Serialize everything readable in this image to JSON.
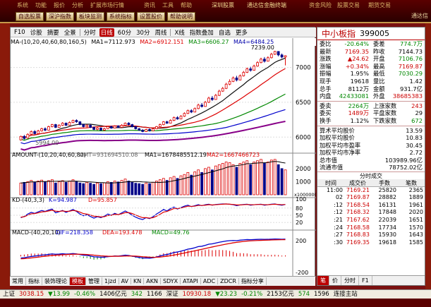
{
  "menu": {
    "row1": [
      "系统",
      "功能",
      "报价",
      "分析",
      "扩展市场行情",
      "资讯",
      "工具",
      "帮助",
      "深圳股票",
      "通达信金融终端",
      "资金风险",
      "股票交易",
      "期货交易"
    ],
    "buttons": [
      "自选股票",
      "深沪指数",
      "板块监测",
      "系统指标",
      "设置股价",
      "帮助说明"
    ],
    "right_label": "通达信"
  },
  "toolbar": {
    "items": [
      "F10",
      "诊股",
      "摘要",
      "全景",
      "分时",
      "日线",
      "60分",
      "30分",
      "周线",
      "X线",
      "指数叠加",
      "自选",
      "更多"
    ],
    "selected": "日线"
  },
  "price_legend": {
    "label": "MA-(10,20,40,60,80,160,5)",
    "ma1": "MA1=7112.973",
    "ma2": "MA2=6912.151",
    "ma3": "MA3=6606.27",
    "ma4": "MA4=6484.25"
  },
  "amount_legend": {
    "label": "AMOUNT-(10,20,40,60,80)",
    "amt": "AMT=931694510.08",
    "ma1": "MA1=1678485512.19",
    "ma2": "MA2=1667466723"
  },
  "kd_legend": {
    "label": "KD-(40,3,3)",
    "k": "K=94.987",
    "d": "D=95.857"
  },
  "macd_legend": {
    "label": "MACD-(40,20,10)",
    "dif": "DIF=218.358",
    "dea": "DEA=193.478",
    "macd": "MACD=49.76"
  },
  "bottomtabs": {
    "items": [
      "常用",
      "指标",
      "装饰理论",
      "模板",
      "管理",
      "1jzd",
      "AV",
      "KN",
      "AKN",
      "SDYX",
      "ATAPI",
      "ADC",
      "ZDCR",
      "指标分享"
    ],
    "selected": "模板"
  },
  "quote": {
    "name": "中小板指",
    "code": "399005",
    "rows": [
      [
        [
          "委比",
          "-20.64%",
          "green"
        ],
        [
          "委差",
          "774.7万",
          "green"
        ]
      ],
      [
        [
          "最新",
          "7169.35",
          "red"
        ],
        [
          "昨收",
          "7144.73",
          ""
        ]
      ],
      [
        [
          "涨跌",
          "▲24.62",
          "red"
        ],
        [
          "开盘",
          "7106.76",
          "green"
        ]
      ],
      [
        [
          "涨幅",
          "+0.34%",
          "red"
        ],
        [
          "最高",
          "7169.87",
          "red"
        ]
      ],
      [
        [
          "振幅",
          "1.95%",
          ""
        ],
        [
          "最低",
          "7030.29",
          "green"
        ]
      ],
      [
        [
          "现手",
          "19618",
          ""
        ],
        [
          "量比",
          "1.42",
          ""
        ]
      ],
      [
        [
          "总手",
          "8112万",
          ""
        ],
        [
          "金额",
          "931.7亿",
          ""
        ]
      ],
      [
        [
          "内盘",
          "42433081",
          "green"
        ],
        [
          "外盘",
          "38685383",
          "red"
        ]
      ]
    ],
    "rows2": [
      [
        [
          "委卖",
          "2264万",
          "green"
        ],
        [
          "上涨家数",
          "243",
          "red"
        ]
      ],
      [
        [
          "委买",
          "1489万",
          "red"
        ],
        [
          "平盘家数",
          "29",
          ""
        ]
      ],
      [
        [
          "换手",
          "1.12%",
          ""
        ],
        [
          "下跌家数",
          "672",
          "green"
        ]
      ]
    ],
    "wide_rows": [
      [
        "算术平均股价",
        "13.59"
      ],
      [
        "加权平均股价",
        "10.83"
      ],
      [
        "加权平均市盈率",
        "30.45"
      ],
      [
        "加权平均市净率",
        "2.72"
      ],
      [
        "总市值",
        "103989.96亿"
      ],
      [
        "流通市值",
        "78752.02亿"
      ]
    ],
    "ticks_title": "分时成交",
    "ticks_header": [
      "时间",
      "成交价",
      "手数",
      "笔数"
    ],
    "ticks": [
      [
        "11:00",
        "7169.21",
        "25820",
        "2365"
      ],
      [
        "02",
        "7169.87",
        "28882",
        "1889"
      ],
      [
        ":12",
        "7168.54",
        "16131",
        "1961"
      ],
      [
        ":12",
        "7168.32",
        "17848",
        "2020"
      ],
      [
        ":21",
        "7167.62",
        "22039",
        "1651"
      ],
      [
        ":24",
        "7168.58",
        "17734",
        "1570"
      ],
      [
        ":27",
        "7168.83",
        "15930",
        "1643"
      ],
      [
        ":30",
        "7169.35",
        "19618",
        "1585"
      ]
    ],
    "tabs": [
      "笔",
      "价",
      "分时",
      "F1"
    ]
  },
  "status": {
    "items": [
      [
        "上证",
        "3038.15",
        "▼13.99",
        "-0.46%",
        "1406亿元"
      ],
      [
        "",
        "342",
        "1166",
        ""
      ],
      [
        "深证",
        "10930.18",
        "▼23.23",
        "-0.21%",
        "2153亿元"
      ],
      [
        "",
        "574",
        "1596",
        ""
      ],
      [
        "",
        "",
        "连接主站",
        ""
      ]
    ]
  },
  "chart_data": {
    "type": "candlestick",
    "x_ticks": [
      "2019/9",
      "10",
      "11",
      "12",
      "2020/1"
    ],
    "y_ticks": [
      6000,
      6500,
      7000
    ],
    "annotations": [
      "7239.00",
      "5994.00"
    ],
    "amount_ticks": [
      1000,
      2000
    ],
    "amount_unit": "x10000000",
    "kd_ticks": [
      80,
      50,
      20
    ],
    "kd_ticks_top": 100,
    "macd_ticks": [
      200
    ],
    "macd_ticks_bottom": -200,
    "candles": [
      [
        5960,
        6010,
        5950,
        6020
      ],
      [
        6010,
        5980,
        5965,
        6030
      ],
      [
        5985,
        6040,
        5975,
        6055
      ],
      [
        6040,
        6080,
        6030,
        6095
      ],
      [
        6080,
        6050,
        6040,
        6100
      ],
      [
        6050,
        6090,
        6045,
        6105
      ],
      [
        6090,
        6120,
        6080,
        6135
      ],
      [
        6120,
        6100,
        6085,
        6140
      ],
      [
        6100,
        6150,
        6095,
        6165
      ],
      [
        6150,
        6180,
        6140,
        6190
      ],
      [
        6180,
        6140,
        6130,
        6190
      ],
      [
        6140,
        6170,
        6135,
        6185
      ],
      [
        6170,
        6200,
        6160,
        6215
      ],
      [
        6200,
        6170,
        6160,
        6210
      ],
      [
        6170,
        6210,
        6165,
        6225
      ],
      [
        6210,
        6240,
        6200,
        6250
      ],
      [
        6240,
        6220,
        6205,
        6255
      ],
      [
        6220,
        6180,
        6170,
        6230
      ],
      [
        6180,
        6150,
        6140,
        6190
      ],
      [
        6150,
        6170,
        6140,
        6185
      ],
      [
        6170,
        6140,
        6130,
        6180
      ],
      [
        6140,
        6110,
        6100,
        6150
      ],
      [
        6110,
        6130,
        6100,
        6145
      ],
      [
        6130,
        6100,
        6090,
        6140
      ],
      [
        6100,
        6120,
        6090,
        6135
      ],
      [
        6120,
        6150,
        6115,
        6160
      ],
      [
        6150,
        6130,
        6120,
        6165
      ],
      [
        6130,
        6160,
        6125,
        6170
      ],
      [
        6160,
        6140,
        6130,
        6170
      ],
      [
        6140,
        6170,
        6135,
        6185
      ],
      [
        6170,
        6200,
        6160,
        6210
      ],
      [
        6200,
        6180,
        6170,
        6215
      ],
      [
        6180,
        6150,
        6140,
        6190
      ],
      [
        6150,
        6120,
        6110,
        6160
      ],
      [
        6120,
        6100,
        6090,
        6130
      ],
      [
        6100,
        6080,
        6070,
        6115
      ],
      [
        6080,
        6110,
        6075,
        6120
      ],
      [
        6110,
        6090,
        6080,
        6125
      ],
      [
        6090,
        6120,
        6085,
        6135
      ],
      [
        6120,
        6150,
        6115,
        6160
      ],
      [
        6150,
        6180,
        6145,
        6195
      ],
      [
        6180,
        6220,
        6170,
        6230
      ],
      [
        6220,
        6200,
        6190,
        6235
      ],
      [
        6200,
        6240,
        6195,
        6255
      ],
      [
        6240,
        6280,
        6230,
        6295
      ],
      [
        6280,
        6260,
        6250,
        6300
      ],
      [
        6260,
        6300,
        6255,
        6315
      ],
      [
        6300,
        6340,
        6290,
        6355
      ],
      [
        6340,
        6380,
        6330,
        6395
      ],
      [
        6380,
        6360,
        6345,
        6400
      ],
      [
        6360,
        6410,
        6355,
        6425
      ],
      [
        6410,
        6460,
        6400,
        6480
      ],
      [
        6460,
        6440,
        6425,
        6490
      ],
      [
        6440,
        6500,
        6435,
        6520
      ],
      [
        6500,
        6560,
        6490,
        6580
      ],
      [
        6560,
        6540,
        6520,
        6590
      ],
      [
        6540,
        6600,
        6535,
        6620
      ],
      [
        6600,
        6660,
        6590,
        6680
      ],
      [
        6660,
        6700,
        6650,
        6720
      ],
      [
        6700,
        6760,
        6690,
        6780
      ],
      [
        6760,
        6800,
        6745,
        6830
      ],
      [
        6800,
        6850,
        6790,
        6870
      ],
      [
        6850,
        6820,
        6800,
        6880
      ],
      [
        6820,
        6880,
        6815,
        6900
      ],
      [
        6880,
        6930,
        6870,
        6950
      ],
      [
        6930,
        6980,
        6920,
        7000
      ],
      [
        6980,
        6960,
        6940,
        7010
      ],
      [
        6960,
        7020,
        6955,
        7040
      ],
      [
        7020,
        7070,
        7010,
        7090
      ],
      [
        7070,
        7120,
        7060,
        7140
      ],
      [
        7120,
        7090,
        7070,
        7150
      ],
      [
        7090,
        7140,
        7085,
        7160
      ],
      [
        7140,
        7190,
        7130,
        7210
      ],
      [
        7190,
        7230,
        7180,
        7239
      ],
      [
        7230,
        7180,
        7160,
        7235
      ],
      [
        7180,
        7150,
        7130,
        7200
      ],
      [
        7150,
        7169,
        7030,
        7175
      ]
    ],
    "amount": [
      900,
      950,
      1000,
      1100,
      980,
      1050,
      1120,
      1000,
      1080,
      1150,
      900,
      1000,
      1080,
      950,
      1050,
      1150,
      1000,
      900,
      850,
      950,
      880,
      800,
      900,
      850,
      920,
      1000,
      950,
      1050,
      980,
      1100,
      1200,
      1050,
      950,
      880,
      850,
      800,
      900,
      850,
      950,
      1050,
      1150,
      1250,
      1100,
      1300,
      1400,
      1250,
      1450,
      1550,
      1700,
      1500,
      1750,
      1900,
      1700,
      2000,
      2100,
      1900,
      2200,
      2300,
      2400,
      2500,
      2450,
      2300,
      2100,
      2400,
      2500,
      2600,
      2300,
      2500,
      2600,
      2700,
      2400,
      2500,
      2650,
      2700,
      2300,
      2000,
      1900
    ],
    "kd_k": [
      40,
      45,
      55,
      62,
      58,
      64,
      70,
      66,
      72,
      76,
      60,
      65,
      70,
      62,
      68,
      74,
      66,
      55,
      48,
      52,
      45,
      38,
      44,
      40,
      46,
      55,
      50,
      58,
      52,
      60,
      68,
      60,
      50,
      42,
      36,
      32,
      40,
      36,
      44,
      55,
      64,
      74,
      68,
      78,
      84,
      76,
      82,
      88,
      92,
      86,
      90,
      94,
      90,
      94,
      96,
      92,
      95,
      96,
      97,
      97,
      96,
      94,
      90,
      93,
      95,
      96,
      92,
      94,
      95,
      96,
      92,
      94,
      96,
      97,
      94,
      92,
      95
    ],
    "kd_d": [
      42,
      44,
      50,
      56,
      57,
      60,
      64,
      65,
      68,
      71,
      67,
      66,
      68,
      66,
      67,
      70,
      68,
      63,
      57,
      55,
      51,
      46,
      45,
      43,
      44,
      49,
      50,
      54,
      53,
      56,
      61,
      61,
      57,
      51,
      45,
      40,
      40,
      38,
      40,
      46,
      54,
      63,
      66,
      72,
      78,
      78,
      80,
      84,
      88,
      87,
      88,
      91,
      91,
      92,
      94,
      93,
      94,
      95,
      96,
      97,
      96,
      95,
      93,
      93,
      94,
      95,
      94,
      94,
      95,
      95,
      94,
      94,
      95,
      96,
      95,
      94,
      95
    ],
    "macd_dif": [
      -20,
      -15,
      -8,
      0,
      5,
      10,
      18,
      20,
      26,
      32,
      28,
      30,
      34,
      30,
      32,
      36,
      32,
      24,
      16,
      14,
      6,
      -4,
      -6,
      -10,
      -8,
      -2,
      0,
      6,
      4,
      10,
      16,
      12,
      4,
      -4,
      -12,
      -20,
      -18,
      -22,
      -16,
      -6,
      6,
      18,
      24,
      36,
      50,
      56,
      66,
      78,
      92,
      98,
      110,
      124,
      128,
      140,
      154,
      158,
      168,
      178,
      186,
      194,
      198,
      200,
      198,
      204,
      208,
      212,
      210,
      212,
      214,
      216,
      214,
      215,
      217,
      219,
      218,
      216,
      218
    ],
    "macd_dea": [
      -30,
      -27,
      -23,
      -18,
      -13,
      -8,
      -2,
      3,
      8,
      13,
      16,
      19,
      22,
      24,
      26,
      28,
      29,
      28,
      26,
      24,
      21,
      16,
      12,
      8,
      5,
      3,
      2,
      3,
      3,
      4,
      6,
      7,
      6,
      4,
      1,
      -3,
      -6,
      -9,
      -11,
      -10,
      -7,
      -2,
      3,
      10,
      18,
      26,
      34,
      43,
      53,
      62,
      71,
      81,
      90,
      100,
      110,
      119,
      128,
      137,
      146,
      155,
      163,
      171,
      177,
      183,
      188,
      193,
      196,
      198,
      200,
      202,
      204,
      205,
      207,
      208,
      209,
      210,
      211
    ]
  }
}
